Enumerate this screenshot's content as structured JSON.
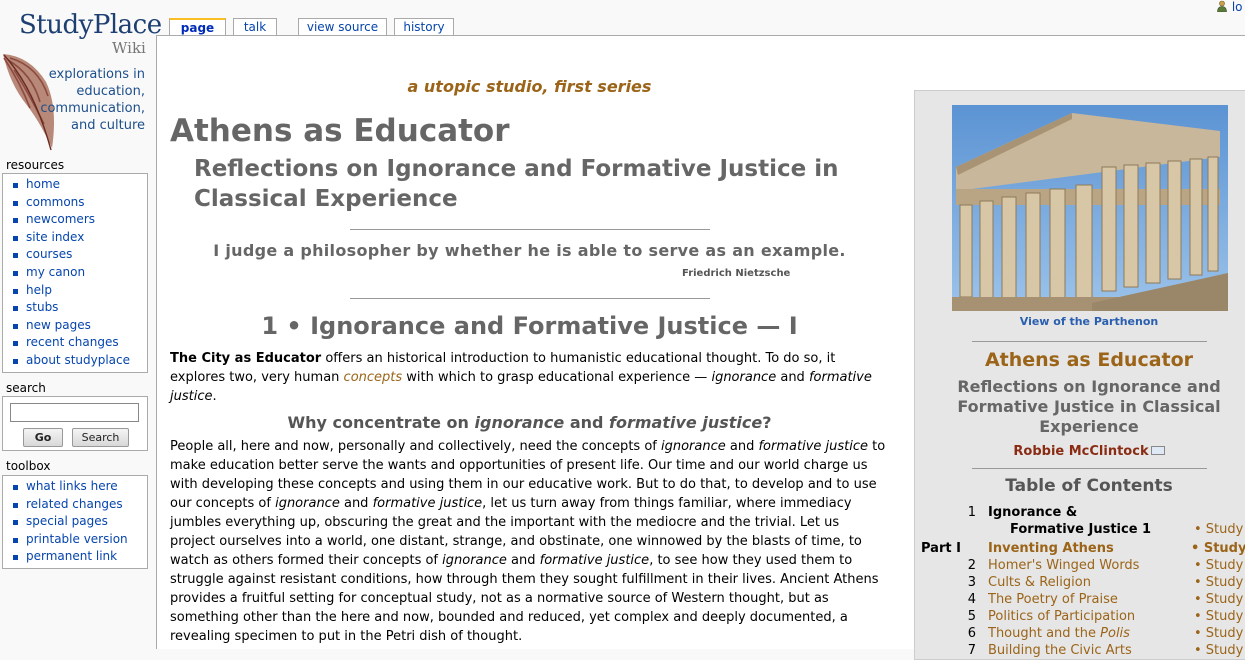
{
  "personal": {
    "login_label": "lo"
  },
  "logo": {
    "name_line1": "StudyPlace",
    "name_line2": "Wiki",
    "tagline": "explorations in education, communication, and culture"
  },
  "sidebar": {
    "resources_title": "resources",
    "resources": [
      "home",
      "commons",
      "newcomers",
      "site index",
      "courses",
      "my canon",
      "help",
      "stubs",
      "new pages",
      "recent changes",
      "about studyplace"
    ],
    "search_title": "search",
    "search_placeholder": "",
    "go_label": "Go",
    "search_label": "Search",
    "toolbox_title": "toolbox",
    "toolbox": [
      "what links here",
      "related changes",
      "special pages",
      "printable version",
      "permanent link"
    ]
  },
  "tabs": [
    {
      "label": "page",
      "selected": true
    },
    {
      "label": "talk",
      "selected": false
    },
    {
      "label": "view source",
      "selected": false
    },
    {
      "label": "history",
      "selected": false
    }
  ],
  "article": {
    "series": "a utopic studio, first series",
    "title": "Athens as Educator",
    "subtitle": "Reflections on Ignorance and Formative Justice in Classical Experience",
    "quote": "I judge a philosopher by whether he is able to serve as an example.",
    "quote_author": "Friedrich Nietzsche",
    "section_heading": "1  •  Ignorance and Formative Justice — I",
    "intro_bold": "The City as Educator",
    "intro_1": " offers an historical introduction to humanistic educational thought.  To do so, it explores two, very human ",
    "intro_link": "concepts",
    "intro_2": " with which to grasp educational experience — ",
    "intro_em1": "ignorance",
    "intro_3": " and ",
    "intro_em2": "formative justice",
    "intro_4": ".",
    "why_1": "Why concentrate on ",
    "why_em1": "ignorance",
    "why_2": " and ",
    "why_em2": "formative justice",
    "why_3": "?",
    "p2_a": "People all, here and now, personally and collectively, need the concepts of ",
    "p2_em1": "ignorance",
    "p2_b": " and ",
    "p2_em2": "formative justice",
    "p2_c": " to make education better serve the wants and opportunities of present life.  Our time and our world charge us with developing these concepts and using them in our educative work.  But to do that, to develop and to use our concepts of ",
    "p2_em3": "ignorance",
    "p2_d": " and ",
    "p2_em4": "formative justice",
    "p2_e": ", let us turn away from things familiar, where immediacy jumbles everything up, obscuring the great and the important with the mediocre and the trivial.  Let us project ourselves into a world, one distant, strange, and obstinate, one winnowed by the blasts of time, to watch as others formed their concepts of ",
    "p2_em5": "ignorance",
    "p2_f": " and ",
    "p2_em6": "formative justice",
    "p2_g": ", to see how they used them to struggle against resistant conditions, how through them they sought fulfillment in their lives.  Ancient Athens provides a fruitful setting for conceptual study, not as a normative source of Western thought, but as something other than the here and now, bounded and reduced, yet complex and deeply documented, a revealing specimen to put in the Petri dish of thought."
  },
  "infobox": {
    "photo_caption": "View of the Parthenon",
    "title": "Athens as Educator",
    "subtitle": "Reflections on Ignorance and Formative Justice in Classical Experience",
    "author": "Robbie McClintock",
    "toc_title": "Table of Contents",
    "toc": [
      {
        "num": "1",
        "label1": "Ignorance &",
        "label2": "Formative Justice 1",
        "study": "• Study",
        "style": "black"
      },
      {
        "num": "Part I",
        "label": "Inventing Athens",
        "study": "• Study",
        "style": "part"
      },
      {
        "num": "2",
        "label": "Homer's Winged Words",
        "study": "• Study",
        "style": "normal"
      },
      {
        "num": "3",
        "label": "Cults & Religion",
        "study": "• Study",
        "style": "normal"
      },
      {
        "num": "4",
        "label": "The Poetry of Praise",
        "study": "• Study",
        "style": "normal"
      },
      {
        "num": "5",
        "label": "Politics of Participation",
        "study": "• Study",
        "style": "normal"
      },
      {
        "num": "6",
        "label": "Thought and the ",
        "label_em": "Polis",
        "study": "• Study",
        "style": "normal"
      },
      {
        "num": "7",
        "label": "Building the Civic Arts",
        "study": "• Study",
        "style": "normal"
      }
    ]
  },
  "colors": {
    "accent": "#9b6418",
    "link": "#0645ad",
    "heading_gray": "#666666",
    "tab_highlight": "#fabd23"
  }
}
